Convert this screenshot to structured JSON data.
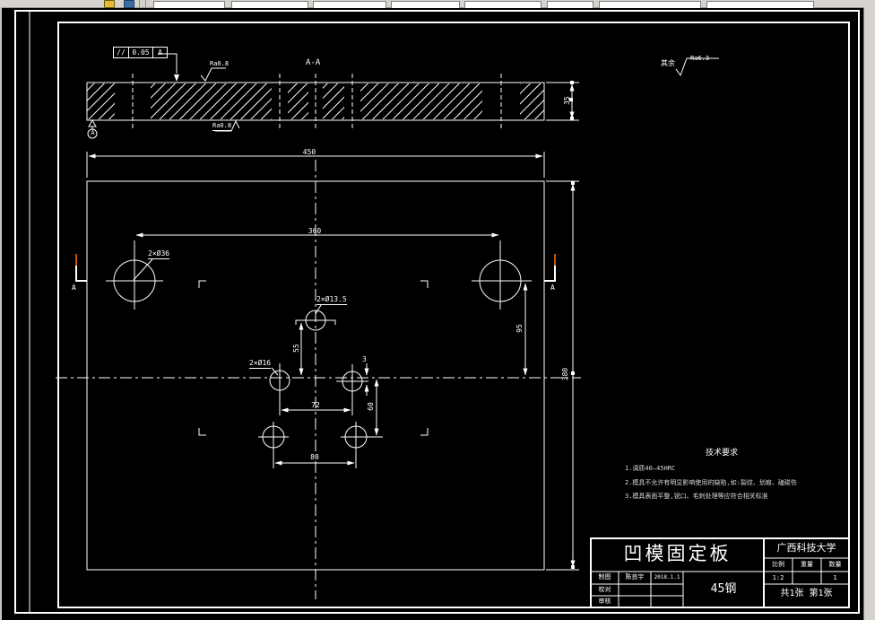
{
  "section_view": {
    "view_label": "A-A",
    "thickness_dim": "35",
    "parallelism": {
      "symbol": "//",
      "tolerance": "0.05",
      "datum": "A"
    },
    "surface_top": "Ra0.8",
    "surface_bottom": "Ra0.8",
    "datum_label": "A"
  },
  "surface_note": {
    "prefix": "其余",
    "roughness": "Ra6.3"
  },
  "plan_view": {
    "dims": {
      "width": "450",
      "height": "380",
      "hole_span": "360",
      "vert_offset": "95",
      "pin_vert": "55",
      "pin_span": "72",
      "lower_span": "80",
      "lower_vert": "60",
      "offset_small": "3"
    },
    "labels": {
      "large_holes": "2×Ø36",
      "center_holes": "2×Ø13.5",
      "small_holes": "2×Ø16"
    },
    "section_marks": {
      "left": "A",
      "right": "A"
    }
  },
  "tech_requirements": {
    "title": "技术要求",
    "items": [
      "1.调质40—45HRC",
      "2.模具不允许有明显影响使用的缺陷,如:裂纹、划痕、磕碰伤",
      "3.模具表面平整,锐口、毛刺处理等应符合相关标准"
    ]
  },
  "title_block": {
    "part_name": "凹模固定板",
    "organization": "广西科技大学",
    "material": "45钢",
    "scale": {
      "label": "比例",
      "value": "1:2"
    },
    "weight": {
      "label": "重量",
      "value": ""
    },
    "quantity": {
      "label": "数量",
      "value": "1"
    },
    "sheet": "共1张 第1张",
    "sign_rows": [
      {
        "label": "制图",
        "name": "陈良宇",
        "date": "2018.1.1"
      },
      {
        "label": "校对",
        "name": "",
        "date": ""
      },
      {
        "label": "审核",
        "name": "",
        "date": ""
      }
    ]
  }
}
